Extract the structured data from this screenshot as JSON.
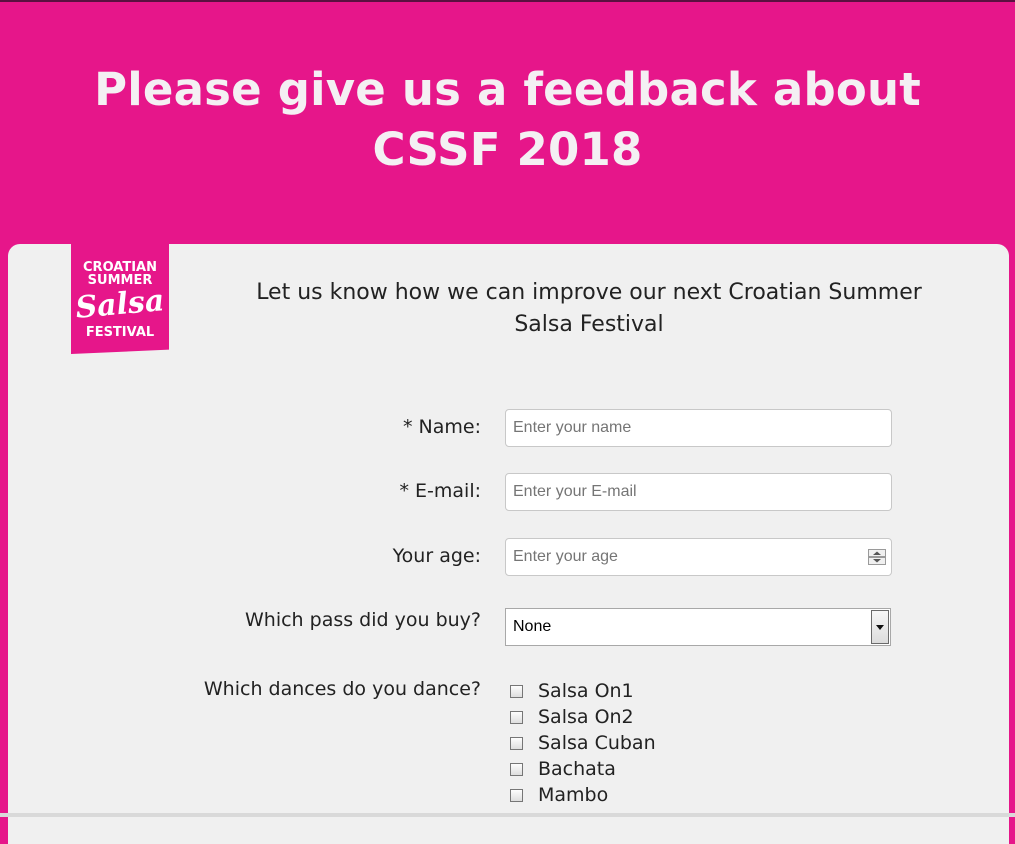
{
  "header": {
    "title_line1": "Please give us a feedback about",
    "title_line2": "CSSF 2018"
  },
  "logo": {
    "line1": "CROATIAN",
    "line2": "SUMMER",
    "line3": "Salsa",
    "line4": "FESTIVAL"
  },
  "form": {
    "subtitle_line1": "Let us know how we can improve our next Croatian Summer",
    "subtitle_line2": "Salsa Festival",
    "name": {
      "label": "* Name:",
      "placeholder": "Enter your name",
      "value": ""
    },
    "email": {
      "label": "* E-mail:",
      "placeholder": "Enter your E-mail",
      "value": ""
    },
    "age": {
      "label": "Your age:",
      "placeholder": "Enter your age",
      "value": ""
    },
    "pass": {
      "label": "Which pass did you buy?",
      "selected": "None"
    },
    "dances": {
      "label": "Which dances do you dance?",
      "options": [
        {
          "label": "Salsa On1",
          "checked": false
        },
        {
          "label": "Salsa On2",
          "checked": false
        },
        {
          "label": "Salsa Cuban",
          "checked": false
        },
        {
          "label": "Bachata",
          "checked": false
        },
        {
          "label": "Mambo",
          "checked": false
        }
      ]
    }
  },
  "colors": {
    "accent": "#e6168a",
    "card": "#f0f0f0",
    "header_text": "#f4f0f3"
  }
}
